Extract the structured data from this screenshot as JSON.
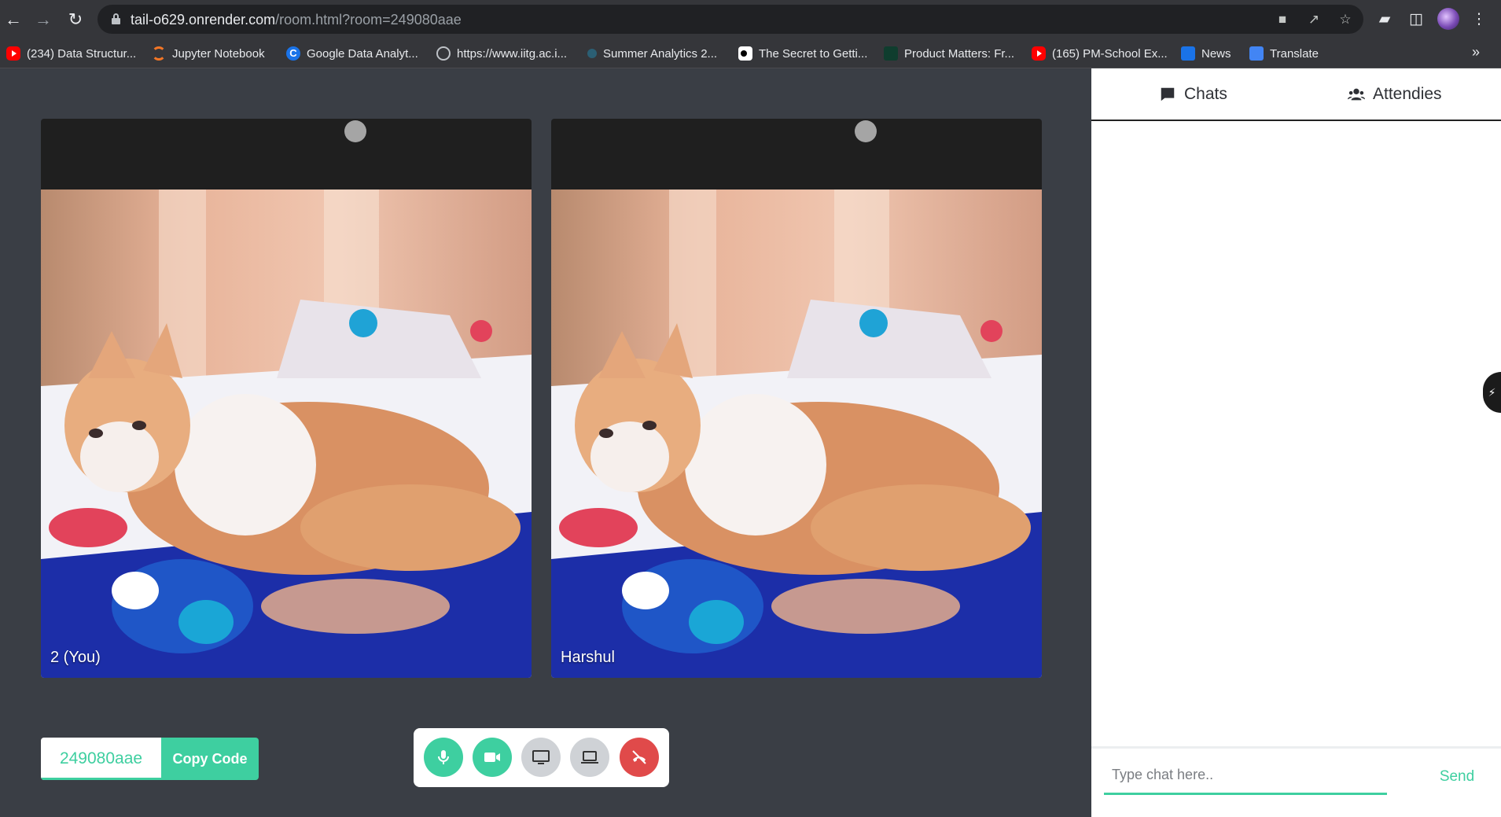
{
  "browser": {
    "url_host": "tail-o629.onrender.com",
    "url_path": "/room.html?room=249080aae",
    "bookmarks": [
      {
        "label": "(234) Data Structur...",
        "icon": "youtube-icon"
      },
      {
        "label": "Jupyter Notebook",
        "icon": "jupyter-icon"
      },
      {
        "label": "Google Data Analyt...",
        "icon": "coursera-icon"
      },
      {
        "label": "https://www.iitg.ac.i...",
        "icon": "globe-icon"
      },
      {
        "label": "Summer Analytics 2...",
        "icon": "summer-analytics-icon"
      },
      {
        "label": "The Secret to Getti...",
        "icon": "medium-icon"
      },
      {
        "label": "Product Matters: Fr...",
        "icon": "product-matters-icon"
      },
      {
        "label": "(165) PM-School Ex...",
        "icon": "youtube-icon"
      },
      {
        "label": "News",
        "icon": "google-news-icon"
      },
      {
        "label": "Translate",
        "icon": "google-translate-icon"
      }
    ]
  },
  "videos": [
    {
      "name": "2 (You)"
    },
    {
      "name": "Harshul"
    }
  ],
  "room": {
    "code": "249080aae",
    "copy_label": "Copy Code"
  },
  "controls": [
    "mic-icon",
    "camera-icon",
    "share-screen-icon",
    "laptop-icon",
    "end-call-icon"
  ],
  "side_panel": {
    "tabs": [
      {
        "label": "Chats",
        "icon": "chat-bubble-icon"
      },
      {
        "label": "Attendies",
        "icon": "users-icon"
      }
    ],
    "chat_placeholder": "Type chat here..",
    "send_label": "Send"
  },
  "colors": {
    "accent": "#3ecfa0",
    "stage_bg": "#3a3e45",
    "end_call": "#e04a4a"
  }
}
